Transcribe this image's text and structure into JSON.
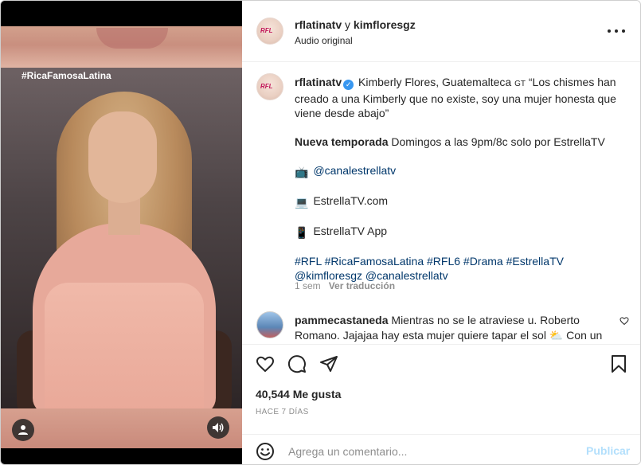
{
  "media": {
    "hashtag_overlay": "#RicaFamosaLatina",
    "icons": {
      "user": "user-icon",
      "audio": "audio-icon"
    }
  },
  "header": {
    "author": "rflatinatv",
    "connector": " y ",
    "coauthor": "kimfloresgz",
    "audio": "Audio original",
    "avatar_mark": "Rica Famosa Latina",
    "more_icon": "more-options-icon"
  },
  "caption": {
    "author": "rflatinatv",
    "intro": " Kimberly Flores, Guatemalteca ",
    "flag": "GT",
    "quote": " “Los chismes han creado a una Kimberly que no existe, soy una mujer honesta que viene desde abajo”",
    "season_bold": "Nueva temporada",
    "season_rest": " Domingos a las 9pm/8c solo por EstrellaTV",
    "tv_icon": "📺",
    "tv_handle": "@canalestrellatv",
    "laptop_icon": "💻",
    "site": "EstrellaTV.com",
    "phone_icon": "📱",
    "app": "EstrellaTV App",
    "hashtags": "#RFL #RicaFamosaLatina #RFL6 #Drama #EstrellaTV",
    "mentions": "@kimfloresgz @canalestrellatv",
    "time": "1 sem",
    "translate": "Ver traducción"
  },
  "comment": {
    "user": "pammecastaneda",
    "text": " Mientras no se le atraviese u. Roberto Romano. Jajajaa hay esta mujer quiere tapar el sol ",
    "emoji": "⛅",
    "tail": " Con un"
  },
  "actions": {
    "like_icon": "heart-icon",
    "comment_icon": "comment-icon",
    "share_icon": "share-icon",
    "save_icon": "bookmark-icon"
  },
  "likes": "40,544 Me gusta",
  "posted": "HACE 7 DÍAS",
  "add_comment": {
    "placeholder": "Agrega un comentario...",
    "post_label": "Publicar"
  },
  "colors": {
    "link": "#00376b",
    "muted": "#8e8e8e",
    "post_disabled": "#b2dffc",
    "verified": "#3897f0"
  }
}
